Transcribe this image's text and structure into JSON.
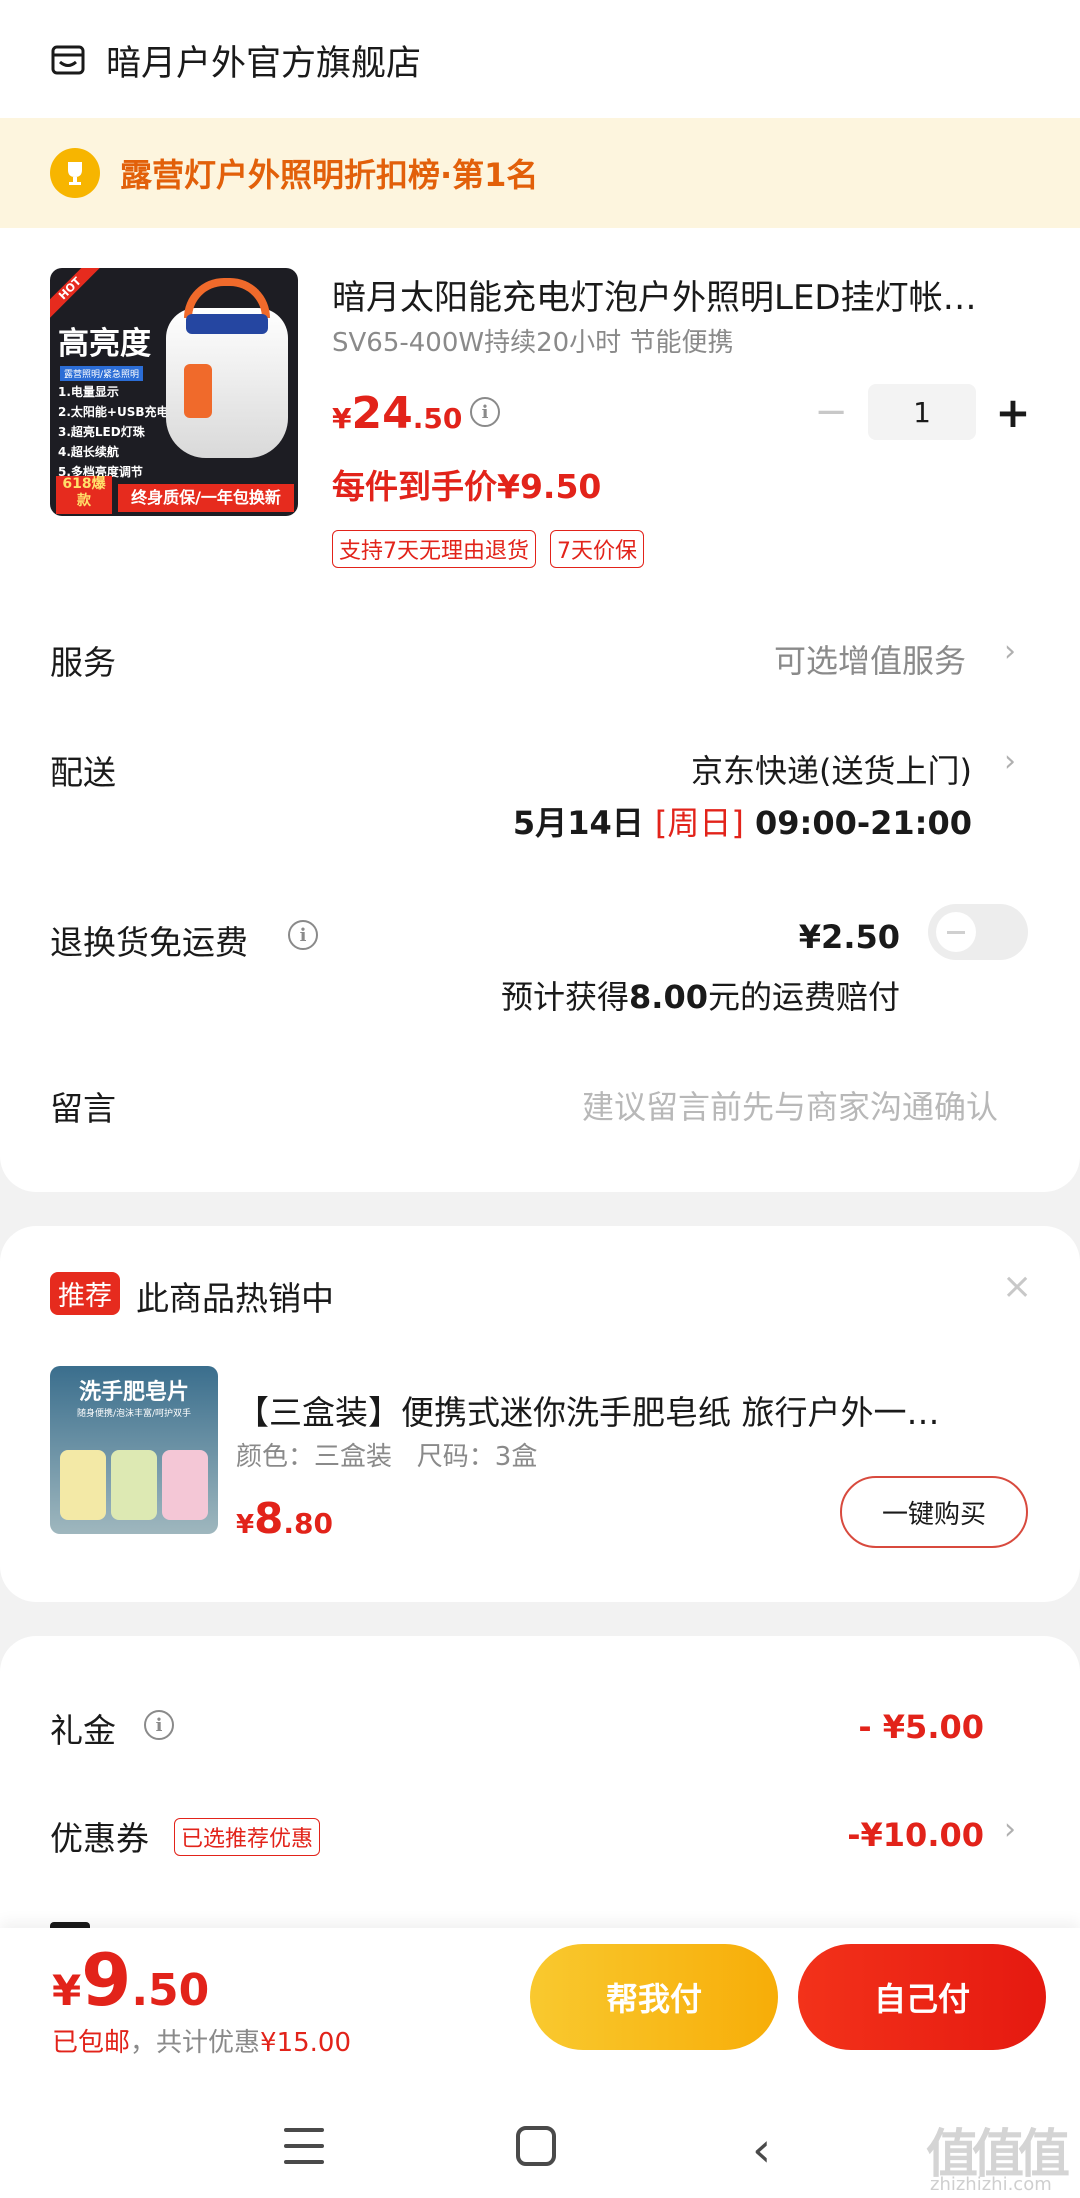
{
  "store": {
    "name": "暗月户外官方旗舰店",
    "icon": "store-icon"
  },
  "ranking": {
    "label": "露营灯户外照明折扣榜·第1名",
    "icon": "trophy-icon"
  },
  "product": {
    "image_texts": {
      "hot": "HOT",
      "headline": "高亮度",
      "subline": "露营照明/紧急照明",
      "features": "1.电量显示\n2.太阳能+USB充电\n3.超亮LED灯珠\n4.超长续航\n5.多档亮度调节",
      "badge": "618爆款",
      "banner": "终身质保/一年包换新"
    },
    "title": "暗月太阳能充电灯泡户外照明LED挂灯帐…",
    "spec": "SV65-400W持续20小时 节能便携",
    "price": {
      "currency": "¥",
      "integer": "24",
      "decimal": ".50"
    },
    "quantity": "1",
    "minus_label": "−",
    "plus_label": "+",
    "arrive_price": "每件到手价¥9.50",
    "tags": [
      "支持7天无理由退货",
      "7天价保"
    ]
  },
  "service": {
    "label": "服务",
    "value": "可选增值服务"
  },
  "delivery": {
    "label": "配送",
    "method": "京东快递(送货上门)",
    "date": "5月14日",
    "day": "[周日]",
    "time": "09:00-21:00"
  },
  "return_shipping": {
    "label": "退换货免运费",
    "price": "¥2.50",
    "note_prefix": "预计获得",
    "note_amount": "8.00",
    "note_suffix": "元的运费赔付",
    "enabled": false
  },
  "message": {
    "label": "留言",
    "placeholder": "建议留言前先与商家沟通确认"
  },
  "recommend": {
    "badge": "推荐",
    "title": "此商品热销中",
    "close": "×",
    "image_texts": {
      "headline": "洗手肥皂片",
      "subline": "随身便携/泡沫丰富/呵护双手"
    },
    "item_name": "【三盒装】便携式迷你洗手肥皂纸 旅行户外一…",
    "item_spec": "颜色：三盒装   尺码：3盒",
    "price": {
      "currency": "¥",
      "integer": "8",
      "decimal": ".80"
    },
    "buy_label": "一键购买"
  },
  "summary": {
    "gift": {
      "label": "礼金",
      "value": "- ¥5.00"
    },
    "coupon": {
      "label": "优惠券",
      "tag": "已选推荐优惠",
      "value": "-¥10.00"
    }
  },
  "paybar": {
    "total": {
      "currency": "¥",
      "integer": "9",
      "decimal": ".50"
    },
    "shipping": "已包邮",
    "separator": "，共计优惠",
    "discount": "¥15.00",
    "help_pay": "帮我付",
    "self_pay": "自己付"
  },
  "navbar": {
    "icons": [
      "menu-icon",
      "home-icon",
      "back-icon"
    ]
  },
  "watermark": {
    "text": "值值值",
    "sub": "zhizhizhi.com"
  },
  "colors": {
    "accent": "#e2231a",
    "ranking_bg": "#fdf5de",
    "help_btn": "#f7ad08"
  }
}
